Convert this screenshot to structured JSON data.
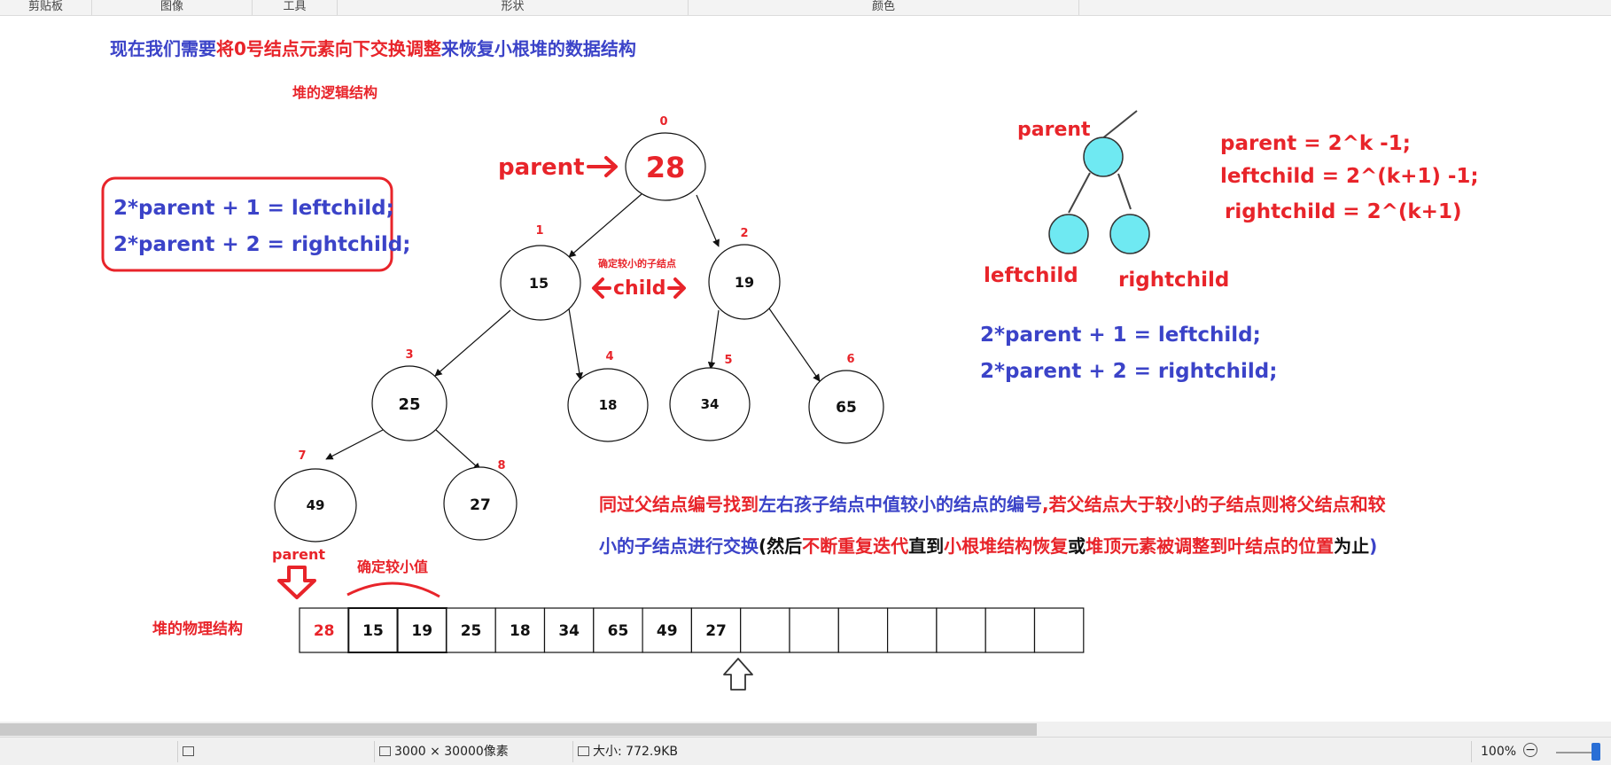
{
  "ribbon": {
    "groups": [
      "剪贴板",
      "图像",
      "工具",
      "形状",
      "颜色"
    ]
  },
  "diagram": {
    "title_parts": [
      {
        "text": "现在我们需要",
        "color": "#3b43c8"
      },
      {
        "text": "将0号结点元素向下交换调整",
        "color": "#e8242a"
      },
      {
        "text": "来恢复小根堆的数据结构",
        "color": "#3b43c8"
      }
    ],
    "logical_label": "堆的逻辑结构",
    "physical_label": "堆的物理结构",
    "formula_box": [
      "2*parent + 1 = leftchild;",
      "2*parent + 2 = rightchild;"
    ],
    "parent_arrow_label": "parent",
    "smaller_child_note": "确定较小的子结点",
    "child_label": "child",
    "tree_nodes": [
      {
        "index": "0",
        "value": "28"
      },
      {
        "index": "1",
        "value": "15"
      },
      {
        "index": "2",
        "value": "19"
      },
      {
        "index": "3",
        "value": "25"
      },
      {
        "index": "4",
        "value": "18"
      },
      {
        "index": "5",
        "value": "34"
      },
      {
        "index": "6",
        "value": "65"
      },
      {
        "index": "7",
        "value": "49"
      },
      {
        "index": "8",
        "value": "27"
      }
    ],
    "mini_tree": {
      "parent": "parent",
      "left": "leftchild",
      "right": "rightchild",
      "node_color": "#6fe9f2"
    },
    "right_formulas": [
      "parent = 2^k -1;",
      "leftchild = 2^(k+1) -1;",
      "rightchild = 2^(k+1)"
    ],
    "right_blue_formulas": [
      "2*parent + 1 = leftchild;",
      "2*parent + 2 = rightchild;"
    ],
    "description_parts": [
      {
        "text": "同过父结点编号找到",
        "color": "#e8242a"
      },
      {
        "text": "左右孩子结点中值较小的结点的编号",
        "color": "#3b43c8"
      },
      {
        "text": ",若父结点大于较小的子结点则将父结点和较",
        "color": "#e8242a"
      },
      {
        "text": "小的子结点进行交换",
        "color": "#3b43c8"
      },
      {
        "text": "(然后",
        "color": "#111111"
      },
      {
        "text": "不断重复迭代",
        "color": "#e8242a"
      },
      {
        "text": "直到",
        "color": "#111111"
      },
      {
        "text": "小根堆结构恢复",
        "color": "#e8242a"
      },
      {
        "text": "或",
        "color": "#111111"
      },
      {
        "text": "堆顶元素被调整到叶结点的位置",
        "color": "#e8242a"
      },
      {
        "text": "为止",
        "color": "#111111"
      },
      {
        "text": ")",
        "color": "#3b43c8"
      }
    ],
    "array_parent_label": "parent",
    "array_min_label": "确定较小值",
    "array_values": [
      "28",
      "15",
      "19",
      "25",
      "18",
      "34",
      "65",
      "49",
      "27",
      "",
      "",
      "",
      "",
      "",
      "",
      ""
    ]
  },
  "status": {
    "dimensions": "3000 × 30000像素",
    "size": "大小: 772.9KB",
    "zoom": "100%"
  },
  "colors": {
    "red": "#e8242a",
    "blue": "#3b43c8",
    "cyan": "#6fe9f2"
  }
}
